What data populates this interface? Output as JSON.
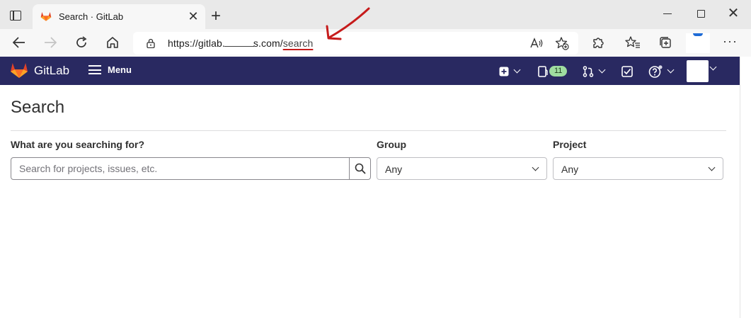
{
  "browser": {
    "tab": {
      "title": "Search · GitLab",
      "close_glyph": "✕"
    },
    "new_tab_glyph": "+",
    "window": {
      "close_glyph": "✕"
    },
    "address": {
      "url_prefix": "https://gitlab.",
      "url_suffix": "s.com/",
      "url_path": "search"
    },
    "more_glyph": "···",
    "icons": [
      "tab-actions-icon",
      "back-icon",
      "forward-icon",
      "refresh-icon",
      "home-icon",
      "lock-icon",
      "read-aloud-icon",
      "add-favorite-icon",
      "extensions-icon",
      "favorites-icon",
      "collections-icon",
      "profile-icon"
    ]
  },
  "gitlab": {
    "brand": "GitLab",
    "menu_label": "Menu",
    "todo_count": "11",
    "icons": [
      "gitlab-logo-icon",
      "hamburger-icon",
      "new-item-icon",
      "issues-icon",
      "merge-requests-icon",
      "todo-icon",
      "help-icon",
      "avatar"
    ]
  },
  "page": {
    "title": "Search",
    "query_label": "What are you searching for?",
    "search_placeholder": "Search for projects, issues, etc.",
    "group_label": "Group",
    "group_value": "Any",
    "project_label": "Project",
    "project_value": "Any"
  },
  "colors": {
    "gitlab_nav": "#292961",
    "gitlab_orange": "#fc6d26",
    "badge_green": "#9fdda0",
    "annotation_red": "#c61b1b"
  }
}
